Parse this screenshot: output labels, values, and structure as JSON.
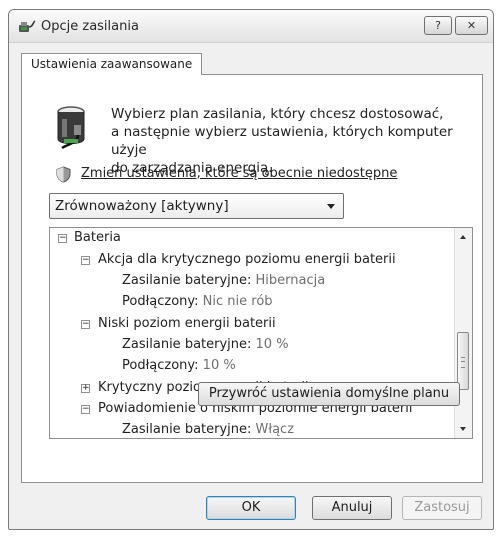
{
  "window": {
    "title": "Opcje zasilania",
    "help_label": "?",
    "close_label": "✕"
  },
  "tab": {
    "label": "Ustawienia zaawansowane"
  },
  "intro": {
    "line1": "Wybierz plan zasilania, który chcesz dostosować,",
    "line2": "a następnie wybierz ustawienia, których komputer użyje",
    "line3": "do zarządzania energią."
  },
  "link": {
    "label": "Zmień ustawienia, które są obecnie niedostępne"
  },
  "plan_select": {
    "value": "Zrównoważony [aktywny]"
  },
  "tree": {
    "root": {
      "label": "Bateria",
      "toggle": "−"
    },
    "critical_action": {
      "label": "Akcja dla krytycznego poziomu energii baterii",
      "toggle": "−",
      "battery_label": "Zasilanie bateryjne:",
      "battery_value": "Hibernacja",
      "plugged_label": "Podłączony:",
      "plugged_value": "Nic nie rób"
    },
    "low_level": {
      "label": "Niski poziom energii baterii",
      "toggle": "−",
      "battery_label": "Zasilanie bateryjne:",
      "battery_value": "10 %",
      "plugged_label": "Podłączony:",
      "plugged_value": "10 %"
    },
    "critical_level": {
      "label": "Krytyczny poziom energii baterii",
      "toggle": "+"
    },
    "low_notification": {
      "label": "Powiadomienie o niskim poziomie energii baterii",
      "toggle": "−",
      "battery_label": "Zasilanie bateryjne:",
      "battery_value": "Włącz"
    }
  },
  "buttons": {
    "restore": "Przywróć ustawienia domyślne planu",
    "ok": "OK",
    "cancel": "Anuluj",
    "apply": "Zastosuj"
  },
  "icons": {
    "app": "power-options-icon",
    "intro": "battery-plug-icon",
    "shield": "uac-shield-icon"
  }
}
